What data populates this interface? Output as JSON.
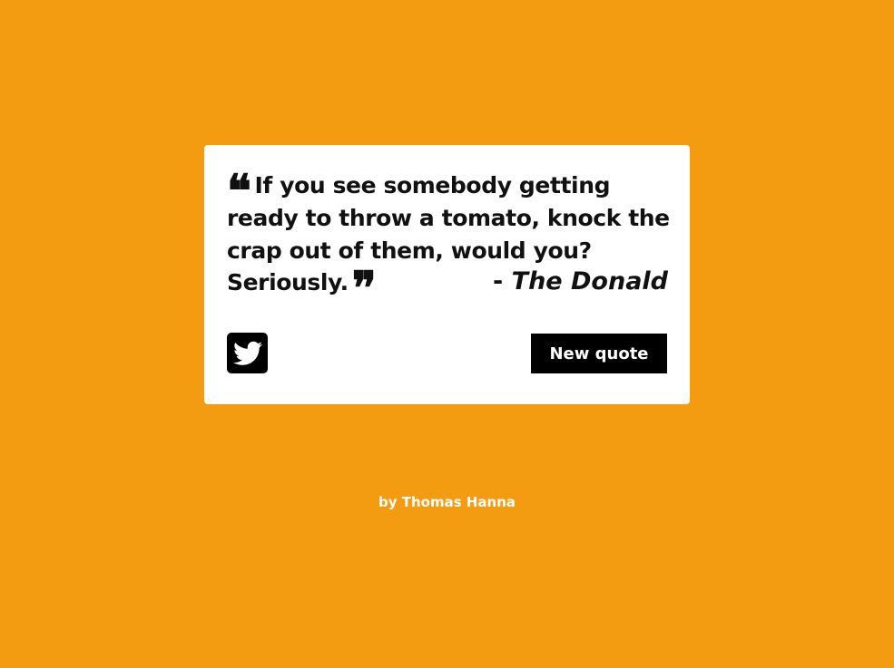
{
  "quote": {
    "text": "If you see somebody getting ready to throw a tomato, knock the crap out of them, would you? Seriously.",
    "open_mark": "❝",
    "close_mark": "❞",
    "author_dash": "- ",
    "author": "The Donald"
  },
  "actions": {
    "tweet_icon": "twitter-icon",
    "new_quote_label": "New quote"
  },
  "footer": {
    "byline": "by Thomas Hanna"
  },
  "colors": {
    "background": "#f39c12",
    "card": "#ffffff",
    "text": "#111111",
    "button": "#000000",
    "button_text": "#ffffff"
  }
}
